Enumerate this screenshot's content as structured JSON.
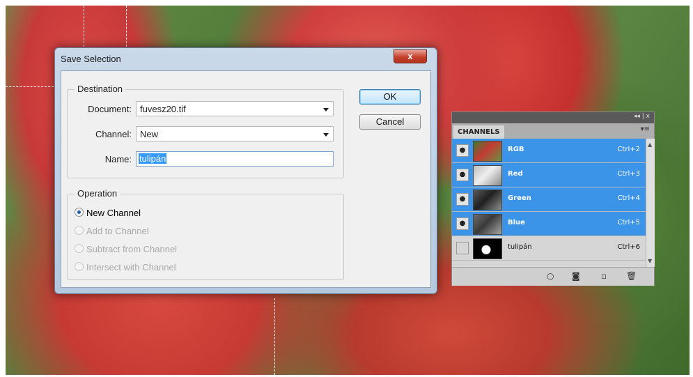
{
  "dialog": {
    "title": "Save Selection",
    "close_label": "x",
    "destination": {
      "legend": "Destination",
      "document_label": "Document:",
      "document_value": "fuvesz20.tif",
      "channel_label": "Channel:",
      "channel_value": "New",
      "name_label": "Name:",
      "name_value": "tulipán"
    },
    "operation": {
      "legend": "Operation",
      "options": [
        {
          "label": "New Channel",
          "selected": true,
          "enabled": true
        },
        {
          "label": "Add to Channel",
          "selected": false,
          "enabled": false
        },
        {
          "label": "Subtract from Channel",
          "selected": false,
          "enabled": false
        },
        {
          "label": "Intersect with Channel",
          "selected": false,
          "enabled": false
        }
      ]
    },
    "ok_label": "OK",
    "cancel_label": "Cancel"
  },
  "channels_panel": {
    "tab_label": "CHANNELS",
    "collapse_controls": "◂◂ | x",
    "menu_icon": "▾≡",
    "channels": [
      {
        "name": "RGB",
        "shortcut": "Ctrl+2",
        "selected": true,
        "visible": true
      },
      {
        "name": "Red",
        "shortcut": "Ctrl+3",
        "selected": true,
        "visible": true
      },
      {
        "name": "Green",
        "shortcut": "Ctrl+4",
        "selected": true,
        "visible": true
      },
      {
        "name": "Blue",
        "shortcut": "Ctrl+5",
        "selected": true,
        "visible": true
      },
      {
        "name": "tulipán",
        "shortcut": "Ctrl+6",
        "selected": false,
        "visible": false
      }
    ],
    "footer_icons": [
      "load-channel-as-selection-icon",
      "save-selection-as-channel-icon",
      "new-channel-icon",
      "delete-channel-icon"
    ]
  },
  "colors": {
    "selection_blue": "#3c94e8",
    "dialog_frame": "#b4c8de",
    "close_red": "#c6412c"
  }
}
